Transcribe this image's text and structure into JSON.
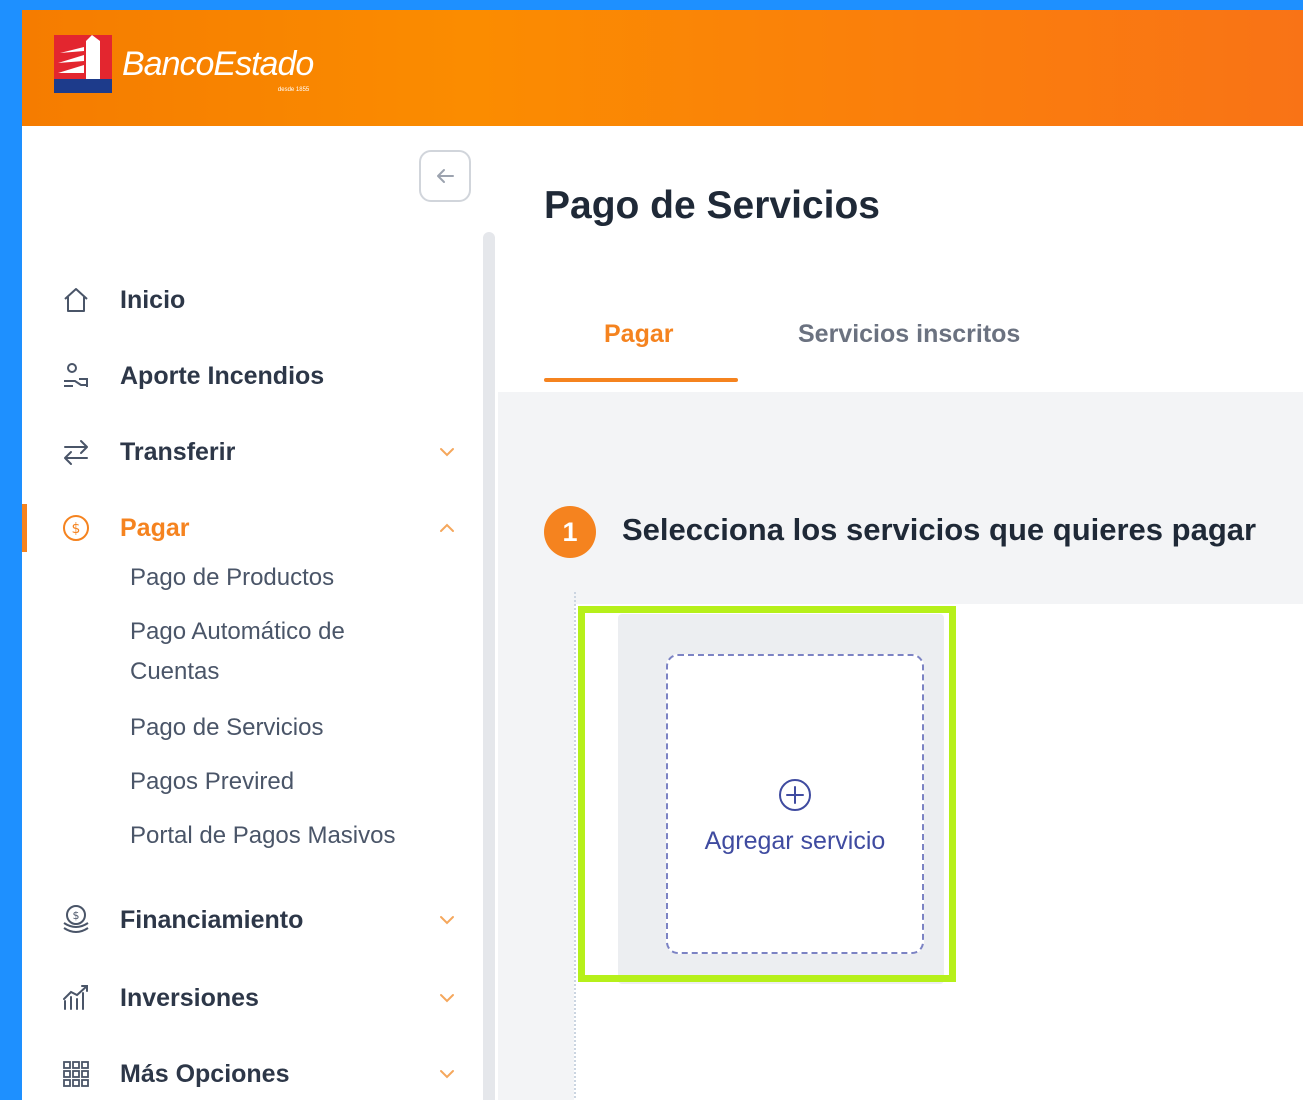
{
  "brand": {
    "name": "BancoEstado",
    "tagline": "desde 1855"
  },
  "sidebar": {
    "collapse_icon": "arrow-left-icon",
    "items": [
      {
        "label": "Inicio",
        "icon": "home-icon"
      },
      {
        "label": "Aporte Incendios",
        "icon": "hand-donation-icon"
      },
      {
        "label": "Transferir",
        "icon": "transfer-arrows-icon"
      },
      {
        "label": "Pagar",
        "icon": "dollar-circle-icon",
        "active": true
      },
      {
        "label": "Financiamiento",
        "icon": "coins-stack-icon"
      },
      {
        "label": "Inversiones",
        "icon": "chart-growth-icon"
      },
      {
        "label": "Más Opciones",
        "icon": "grid-icon"
      }
    ],
    "pagar_subitems": [
      "Pago de Productos",
      "Pago Automático de Cuentas",
      "Pago de Servicios",
      "Pagos Previred",
      "Portal de Pagos Masivos"
    ]
  },
  "main": {
    "title": "Pago de Servicios",
    "tabs": [
      {
        "label": "Pagar",
        "active": true
      },
      {
        "label": "Servicios inscritos",
        "active": false
      }
    ],
    "step": {
      "number": "1",
      "title": "Selecciona los servicios que quieres pagar"
    },
    "add_card": {
      "label": "Agregar servicio",
      "icon": "plus-circle-icon"
    }
  },
  "colors": {
    "accent": "#f5831f",
    "highlight": "#b6f01a",
    "link": "#3f4ba0",
    "page_bg": "#1e90ff"
  }
}
